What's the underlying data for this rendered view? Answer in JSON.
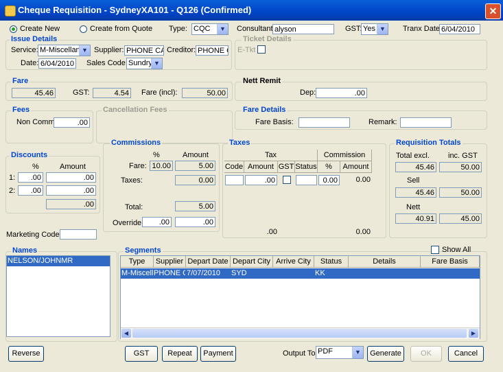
{
  "window": {
    "title": "Cheque Requisition - SydneyXA101 - Q126 (Confirmed)",
    "close_icon": "close-icon"
  },
  "top": {
    "create_new": "Create New",
    "create_from_quote": "Create from Quote",
    "type_label": "Type:",
    "type_value": "CQC",
    "consultant_label": "Consultant:",
    "consultant_value": "alyson",
    "gst_label": "GST:",
    "gst_value": "Yes",
    "tranx_label": "Tranx Date:",
    "tranx_value": "6/04/2010"
  },
  "issue": {
    "title": "Issue Details",
    "service_label": "Service:",
    "service_value": "M-Miscellane",
    "supplier_label": "Supplier:",
    "supplier_value": "PHONE CAR",
    "creditor_label": "Creditor:",
    "creditor_value": "PHONE CA",
    "date_label": "Date:",
    "date_value": "6/04/2010",
    "sales_label": "Sales Code:",
    "sales_value": "Sundry"
  },
  "ticket": {
    "title": "Ticket Details",
    "etkt_label": "E-Tkt"
  },
  "fare": {
    "title": "Fare",
    "fare_value": "45.46",
    "gst_label": "GST:",
    "gst_value": "4.54",
    "incl_label": "Fare (incl):",
    "incl_value": "50.00"
  },
  "nett_remit": {
    "title": "Nett Remit",
    "dep_label": "Dep:",
    "dep_value": ".00"
  },
  "fees": {
    "title": "Fees",
    "noncomm_label": "Non Comm:",
    "noncomm_value": ".00"
  },
  "cancellation": {
    "title": "Cancellation Fees"
  },
  "fare_details": {
    "title": "Fare Details",
    "basis_label": "Fare Basis:",
    "remark_label": "Remark:"
  },
  "discounts": {
    "title": "Discounts",
    "pct_header": "%",
    "amount_header": "Amount",
    "rows": [
      {
        "label": "1:",
        "pct": ".00",
        "amount": ".00"
      },
      {
        "label": "2:",
        "pct": ".00",
        "amount": ".00"
      }
    ],
    "total": ".00"
  },
  "commissions": {
    "title": "Commissions",
    "pct_header": "%",
    "amount_header": "Amount",
    "fare_label": "Fare:",
    "fare_pct": "10.00",
    "fare_amount": "5.00",
    "taxes_label": "Taxes:",
    "taxes_amount": "0.00",
    "total_label": "Total:",
    "total_amount": "5.00",
    "override_label": "Override:",
    "override_pct": ".00",
    "override_amount": ".00"
  },
  "taxes": {
    "title": "Taxes",
    "tax_group": "Tax",
    "commission_group": "Commission",
    "headers": [
      "Code",
      "Amount",
      "GST",
      "Status",
      "%",
      "Amount"
    ],
    "row": {
      "code": "",
      "amount": ".00",
      "status": "",
      "pct": "0.00",
      "comm_amount": "0.00"
    },
    "footer_amount": ".00",
    "footer_comm": "0.00"
  },
  "totals": {
    "title": "Requisition Totals",
    "excl_label": "Total excl.",
    "incl_label": "inc. GST",
    "total_excl": "45.46",
    "total_incl": "50.00",
    "sell_label": "Sell",
    "sell_excl": "45.46",
    "sell_incl": "50.00",
    "nett_label": "Nett",
    "nett_excl": "40.91",
    "nett_incl": "45.00"
  },
  "marketing": {
    "label": "Marketing Code:"
  },
  "names": {
    "title": "Names",
    "items": [
      "NELSON/JOHNMR"
    ]
  },
  "segments": {
    "title": "Segments",
    "show_all": "Show All",
    "headers": [
      "Type",
      "Supplier",
      "Depart Date",
      "Depart City",
      "Arrive City",
      "Status",
      "Details",
      "Fare Basis"
    ],
    "rows": [
      {
        "type": "M-Miscell",
        "supplier": "PHONE CA",
        "depart_date": "7/07/2010",
        "depart_city": "SYD",
        "arrive_city": "",
        "status": "KK",
        "details": "",
        "fare_basis": ""
      }
    ]
  },
  "footer": {
    "reverse": "Reverse",
    "gst": "GST",
    "repeat": "Repeat",
    "payment": "Payment",
    "output_label": "Output To:",
    "output_value": "PDF",
    "generate": "Generate",
    "ok": "OK",
    "cancel": "Cancel"
  }
}
